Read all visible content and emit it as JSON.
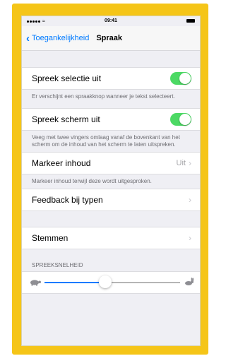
{
  "status_bar": {
    "time": "09:41"
  },
  "nav": {
    "back_label": "Toegankelijkheid",
    "title": "Spraak"
  },
  "settings": {
    "speak_selection": {
      "label": "Spreek selectie uit",
      "on": true,
      "footer": "Er verschijnt een spraakknop wanneer je tekst selecteert."
    },
    "speak_screen": {
      "label": "Spreek scherm uit",
      "on": true,
      "footer": "Veeg met twee vingers omlaag vanaf de bovenkant van het scherm om de inhoud van het scherm te laten uitspreken."
    },
    "highlight_content": {
      "label": "Markeer inhoud",
      "value": "Uit",
      "footer": "Markeer inhoud terwijl deze wordt uitgesproken."
    },
    "typing_feedback": {
      "label": "Feedback bij typen"
    },
    "voices": {
      "label": "Stemmen"
    },
    "speaking_rate": {
      "header": "SPREEKSNELHEID",
      "fraction": 0.45
    }
  },
  "colors": {
    "frame": "#f5c518",
    "accent": "#007aff",
    "toggle_on": "#4cd964"
  },
  "icons": {
    "back": "chevron-left-icon",
    "disclosure": "chevron-right-icon",
    "slow": "turtle-icon",
    "fast": "hare-icon"
  }
}
